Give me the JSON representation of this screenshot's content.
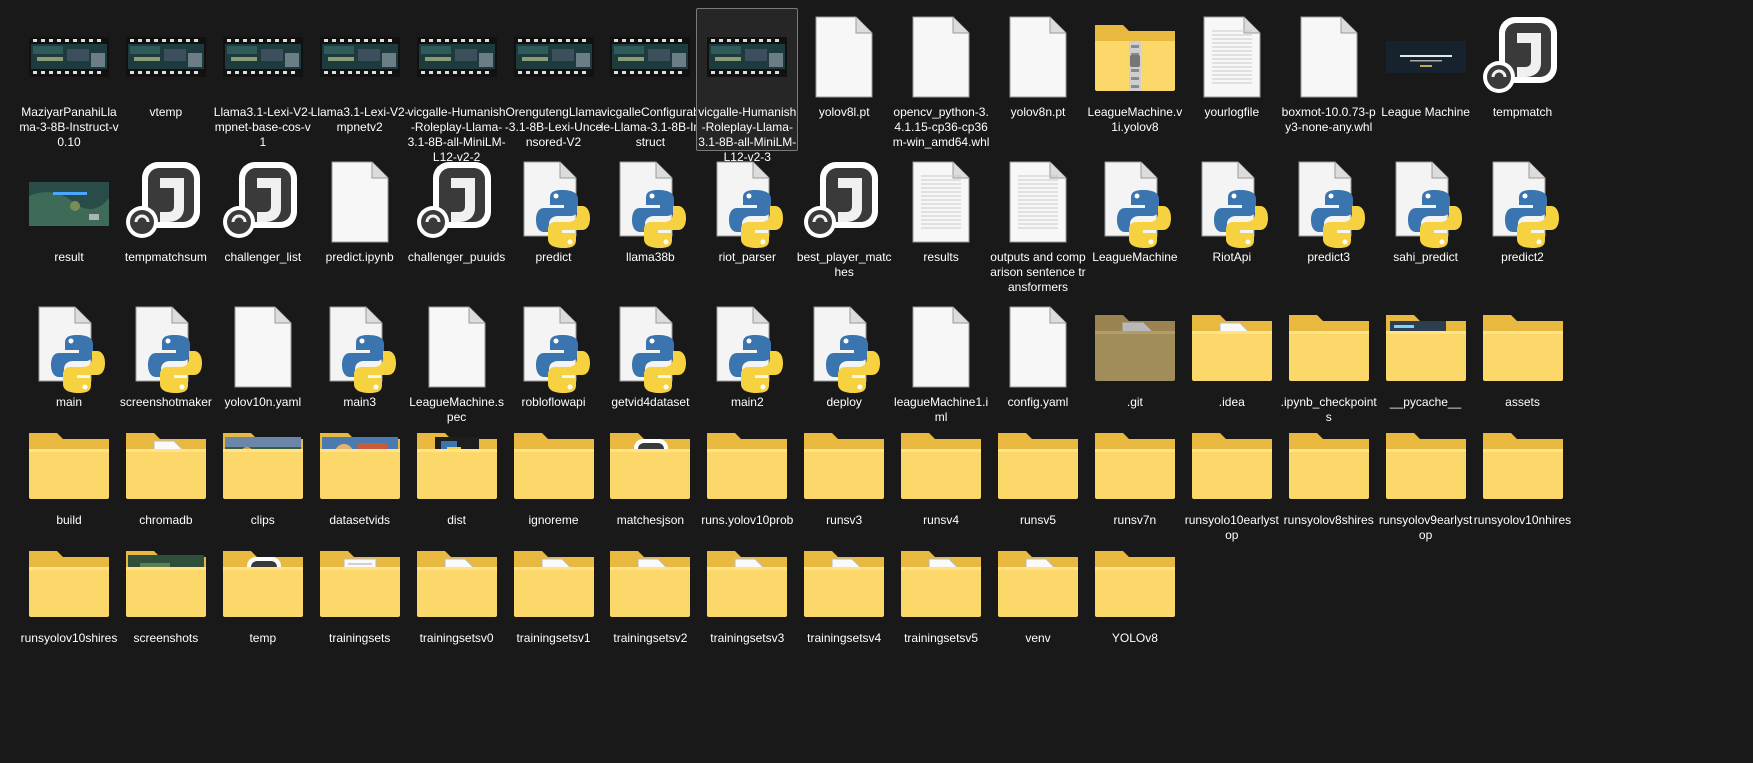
{
  "window": {
    "view": "Large icons"
  },
  "items": [
    {
      "label": "MaziyarPanahiLlama-3-8B-Instruct-v0.10",
      "icon": "video-thumbnail-icon",
      "kind": "video"
    },
    {
      "label": "vtemp",
      "icon": "video-thumbnail-icon",
      "kind": "video"
    },
    {
      "label": "Llama3.1-Lexi-V2-mpnet-base-cos-v1",
      "icon": "video-thumbnail-icon",
      "kind": "video"
    },
    {
      "label": "Llama3.1-Lexi-V2-mpnetv2",
      "icon": "video-thumbnail-icon",
      "kind": "video"
    },
    {
      "label": "vicgalle-Humanish-Roleplay-Llama-3.1-8B-all-MiniLM-L12-v2-2",
      "icon": "video-thumbnail-icon",
      "kind": "video"
    },
    {
      "label": "OrengutengLlama-3.1-8B-Lexi-Uncensored-V2",
      "icon": "video-thumbnail-icon",
      "kind": "video"
    },
    {
      "label": "vicgalleConfigurable-Llama-3.1-8B-Instruct",
      "icon": "video-thumbnail-icon",
      "kind": "video"
    },
    {
      "label": "vicgalle-Humanish-Roleplay-Llama-3.1-8B-all-MiniLM-L12-v2-3",
      "icon": "video-thumbnail-icon",
      "kind": "video",
      "selected": true
    },
    {
      "label": "yolov8l.pt",
      "icon": "blank-file-icon",
      "kind": "blank"
    },
    {
      "label": "opencv_python-3.4.1.15-cp36-cp36m-win_amd64.whl",
      "icon": "blank-file-icon",
      "kind": "blank"
    },
    {
      "label": "yolov8n.pt",
      "icon": "blank-file-icon",
      "kind": "blank"
    },
    {
      "label": "LeagueMachine.v1i.yolov8",
      "icon": "zip-folder-icon",
      "kind": "zip"
    },
    {
      "label": "yourlogfile",
      "icon": "text-file-icon",
      "kind": "text"
    },
    {
      "label": "boxmot-10.0.73-py3-none-any.whl",
      "icon": "blank-file-icon",
      "kind": "blank"
    },
    {
      "label": "League Machine",
      "icon": "image-thumbnail-icon",
      "kind": "banner"
    },
    {
      "label": "tempmatch",
      "icon": "jupyter-notebook-icon",
      "kind": "notebook"
    },
    {
      "label": "result",
      "icon": "image-thumbnail-icon",
      "kind": "map"
    },
    {
      "label": "tempmatchsum",
      "icon": "jupyter-notebook-icon",
      "kind": "notebook"
    },
    {
      "label": "challenger_list",
      "icon": "jupyter-notebook-icon",
      "kind": "notebook"
    },
    {
      "label": "predict.ipynb",
      "icon": "blank-file-icon",
      "kind": "blank"
    },
    {
      "label": "challenger_puuids",
      "icon": "jupyter-notebook-icon",
      "kind": "notebook"
    },
    {
      "label": "predict",
      "icon": "python-file-icon",
      "kind": "python"
    },
    {
      "label": "llama38b",
      "icon": "python-file-icon",
      "kind": "python"
    },
    {
      "label": "riot_parser",
      "icon": "python-file-icon",
      "kind": "python"
    },
    {
      "label": "best_player_matches",
      "icon": "jupyter-notebook-icon",
      "kind": "notebook"
    },
    {
      "label": "results",
      "icon": "text-file-icon",
      "kind": "text"
    },
    {
      "label": "outputs and comparison sentence transformers",
      "icon": "text-file-icon",
      "kind": "text"
    },
    {
      "label": "LeagueMachine",
      "icon": "python-file-icon",
      "kind": "python"
    },
    {
      "label": "RiotApi",
      "icon": "python-file-icon",
      "kind": "python"
    },
    {
      "label": "predict3",
      "icon": "python-file-icon",
      "kind": "python"
    },
    {
      "label": "sahi_predict",
      "icon": "python-file-icon",
      "kind": "python"
    },
    {
      "label": "predict2",
      "icon": "python-file-icon",
      "kind": "python"
    },
    {
      "label": "main",
      "icon": "python-file-icon",
      "kind": "python"
    },
    {
      "label": "screenshotmaker",
      "icon": "python-file-icon",
      "kind": "python"
    },
    {
      "label": "yolov10n.yaml",
      "icon": "blank-file-icon",
      "kind": "blank"
    },
    {
      "label": "main3",
      "icon": "python-file-icon",
      "kind": "python"
    },
    {
      "label": "LeagueMachine.spec",
      "icon": "blank-file-icon",
      "kind": "blank"
    },
    {
      "label": "robloflowapi",
      "icon": "python-file-icon",
      "kind": "python"
    },
    {
      "label": "getvid4dataset",
      "icon": "python-file-icon",
      "kind": "python"
    },
    {
      "label": "main2",
      "icon": "python-file-icon",
      "kind": "python"
    },
    {
      "label": "deploy",
      "icon": "python-file-icon",
      "kind": "python"
    },
    {
      "label": "leagueMachine1.iml",
      "icon": "blank-file-icon",
      "kind": "blank"
    },
    {
      "label": "config.yaml",
      "icon": "blank-file-icon",
      "kind": "blank"
    },
    {
      "label": ".git",
      "icon": "hidden-folder-icon",
      "kind": "folder-hidden"
    },
    {
      "label": ".idea",
      "icon": "folder-icon",
      "kind": "folder-doc"
    },
    {
      "label": ".ipynb_checkpoints",
      "icon": "folder-icon",
      "kind": "folder"
    },
    {
      "label": "__pycache__",
      "icon": "folder-icon",
      "kind": "folder-pycache"
    },
    {
      "label": "assets",
      "icon": "folder-icon",
      "kind": "folder"
    },
    {
      "label": "build",
      "icon": "folder-icon",
      "kind": "folder"
    },
    {
      "label": "chromadb",
      "icon": "folder-icon",
      "kind": "folder-doc"
    },
    {
      "label": "clips",
      "icon": "folder-icon",
      "kind": "folder-clips"
    },
    {
      "label": "datasetvids",
      "icon": "folder-icon",
      "kind": "folder-datasetvids"
    },
    {
      "label": "dist",
      "icon": "folder-icon",
      "kind": "folder-dist"
    },
    {
      "label": "ignoreme",
      "icon": "folder-icon",
      "kind": "folder"
    },
    {
      "label": "matchesjson",
      "icon": "folder-icon",
      "kind": "folder-notebook"
    },
    {
      "label": "runs.yolov10prob",
      "icon": "folder-icon",
      "kind": "folder"
    },
    {
      "label": "runsv3",
      "icon": "folder-icon",
      "kind": "folder"
    },
    {
      "label": "runsv4",
      "icon": "folder-icon",
      "kind": "folder"
    },
    {
      "label": "runsv5",
      "icon": "folder-icon",
      "kind": "folder"
    },
    {
      "label": "runsv7n",
      "icon": "folder-icon",
      "kind": "folder"
    },
    {
      "label": "runsyolo10earlystop",
      "icon": "folder-icon",
      "kind": "folder"
    },
    {
      "label": "runsyolov8shires",
      "icon": "folder-icon",
      "kind": "folder"
    },
    {
      "label": "runsyolov9earlystop",
      "icon": "folder-icon",
      "kind": "folder"
    },
    {
      "label": "runsyolov10nhires",
      "icon": "folder-icon",
      "kind": "folder"
    },
    {
      "label": "runsyolov10shires",
      "icon": "folder-icon",
      "kind": "folder"
    },
    {
      "label": "screenshots",
      "icon": "folder-icon",
      "kind": "folder-screenshots"
    },
    {
      "label": "temp",
      "icon": "folder-icon",
      "kind": "folder-notebook"
    },
    {
      "label": "trainingsets",
      "icon": "folder-icon",
      "kind": "folder-text"
    },
    {
      "label": "trainingsetsv0",
      "icon": "folder-icon",
      "kind": "folder-doc"
    },
    {
      "label": "trainingsetsv1",
      "icon": "folder-icon",
      "kind": "folder-doc"
    },
    {
      "label": "trainingsetsv2",
      "icon": "folder-icon",
      "kind": "folder-doc"
    },
    {
      "label": "trainingsetsv3",
      "icon": "folder-icon",
      "kind": "folder-doc"
    },
    {
      "label": "trainingsetsv4",
      "icon": "folder-icon",
      "kind": "folder-doc"
    },
    {
      "label": "trainingsetsv5",
      "icon": "folder-icon",
      "kind": "folder-doc"
    },
    {
      "label": "venv",
      "icon": "folder-icon",
      "kind": "folder-doc"
    },
    {
      "label": "YOLOv8",
      "icon": "folder-icon",
      "kind": "folder"
    }
  ]
}
